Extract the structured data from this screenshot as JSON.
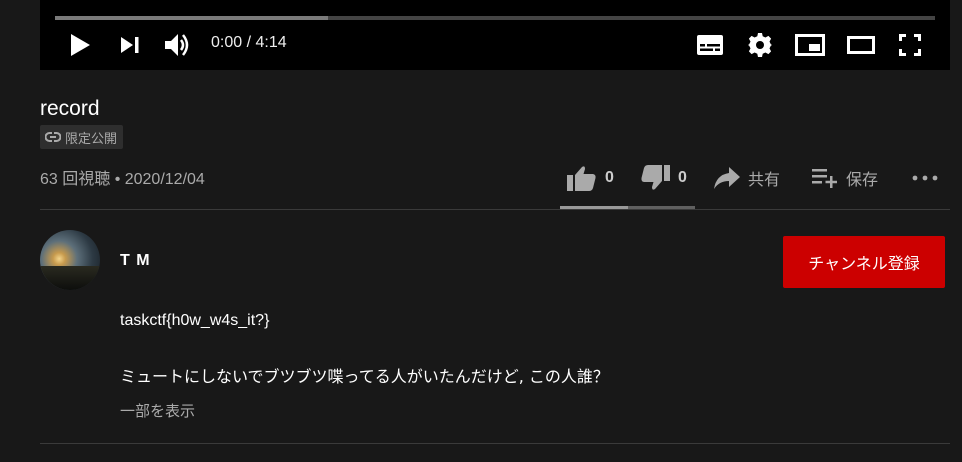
{
  "player": {
    "time_display": "0:00 / 4:14",
    "progress_fraction": 0.31,
    "controls": [
      "play-icon",
      "next-icon",
      "volume-icon",
      "subtitles-icon",
      "settings-icon",
      "miniplayer-icon",
      "theater-icon",
      "fullscreen-icon"
    ]
  },
  "video": {
    "title": "record",
    "visibility": "限定公開",
    "meta": "63 回視聴 • 2020/12/04"
  },
  "actions": {
    "like_count": "0",
    "dislike_count": "0",
    "share_label": "共有",
    "save_label": "保存",
    "like_ratio": 0.5
  },
  "channel": {
    "name": "T M",
    "subscribe_label": "チャンネル登録"
  },
  "description": {
    "line1": "taskctf{h0w_w4s_it?}",
    "line2": "ミュートにしないでブツブツ喋ってる人がいたんだけど, この人誰？",
    "show_more": "一部を表示"
  },
  "colors": {
    "background": "#181818",
    "subscribe": "#cc0000",
    "muted_text": "#aaaaaa"
  }
}
